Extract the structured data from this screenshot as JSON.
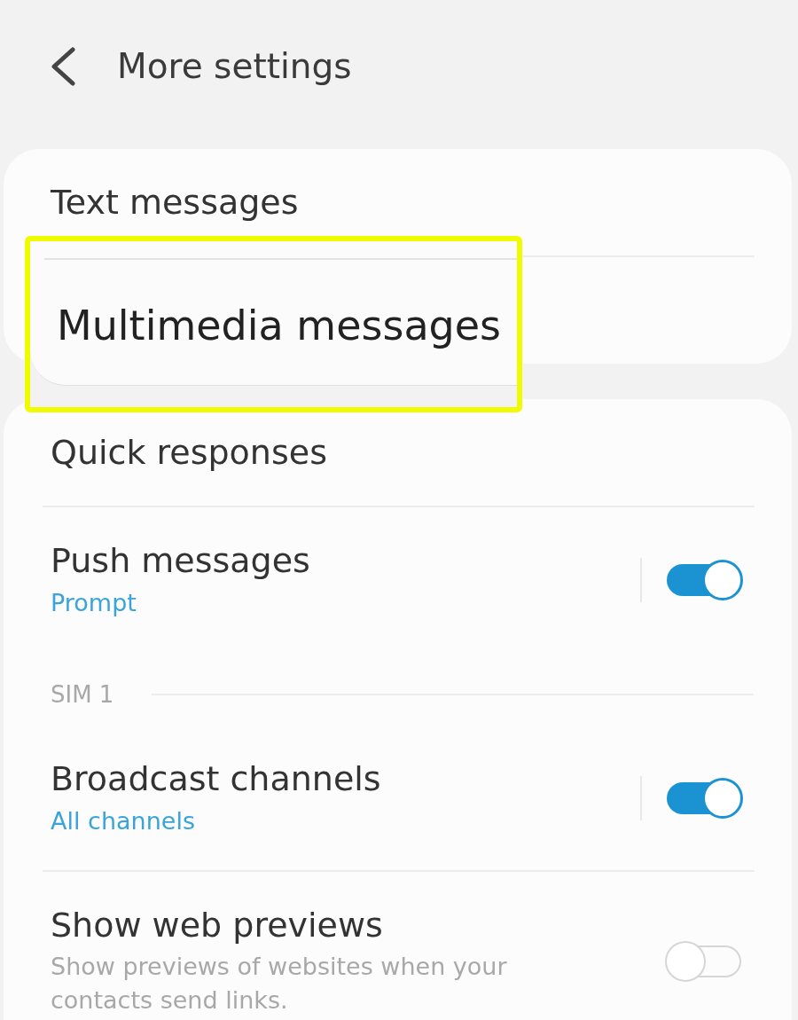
{
  "header": {
    "title": "More settings"
  },
  "cards": [
    {
      "items": [
        {
          "kind": "link",
          "title": "Text messages",
          "highlighted": false
        },
        {
          "kind": "link",
          "title": "Multimedia messages",
          "highlighted": true
        }
      ]
    },
    {
      "items": [
        {
          "kind": "link",
          "title": "Quick responses",
          "highlighted": false
        },
        {
          "kind": "toggle",
          "title": "Push messages",
          "subtitle": "Prompt",
          "on": true
        },
        {
          "kind": "section",
          "title": "SIM 1"
        },
        {
          "kind": "toggle",
          "title": "Broadcast channels",
          "subtitle": "All channels",
          "on": true
        },
        {
          "kind": "toggle",
          "title": "Show web previews",
          "description": "Show previews of websites when your contacts send links.",
          "on": false
        }
      ]
    }
  ]
}
